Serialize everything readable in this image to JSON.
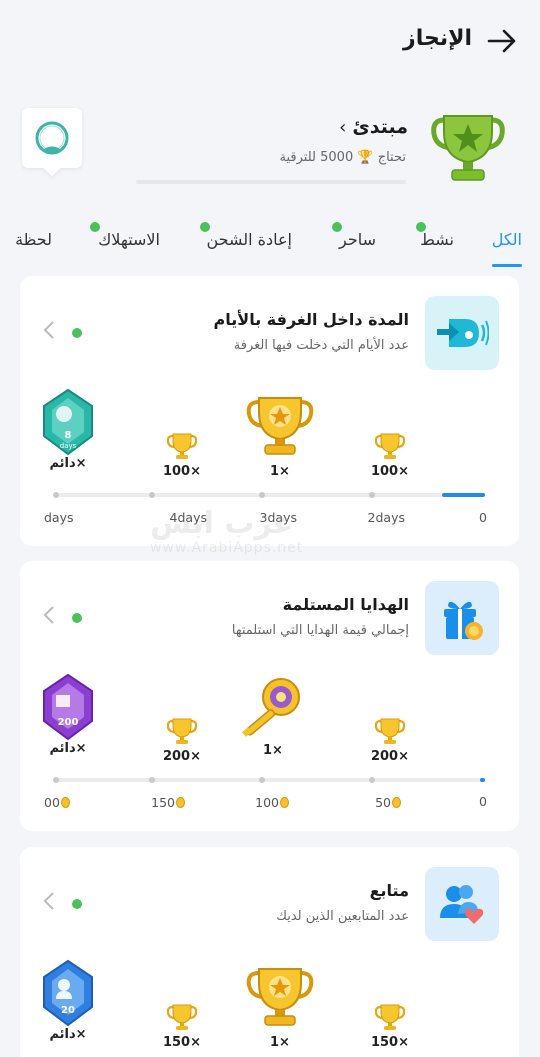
{
  "header": {
    "title": "الإنجاز",
    "back_icon": "arrow-right-icon"
  },
  "rank": {
    "name": "مبتدئ",
    "need_prefix": "تحتاج",
    "need_amount": "5000",
    "need_suffix": "للترقية",
    "progress": 0.0,
    "trophy_color": "#7cbf2a"
  },
  "tabs": [
    {
      "label": "الكل",
      "active": true,
      "dot": false
    },
    {
      "label": "نشط",
      "active": false,
      "dot": true
    },
    {
      "label": "ساحر",
      "active": false,
      "dot": true
    },
    {
      "label": "إعادة الشحن",
      "active": false,
      "dot": true
    },
    {
      "label": "الاستهلاك",
      "active": false,
      "dot": true
    },
    {
      "label": "لحظة",
      "active": false,
      "dot": false
    }
  ],
  "cards": [
    {
      "title": "المدة داخل الغرفة بالأيام",
      "subtitle": "عدد الأيام التي دخلت فيها الغرفة",
      "icon": "room-enter-icon",
      "icon_bg": "#dff3fb",
      "rewards": [
        "100×",
        "1×",
        "100×",
        "دائم×"
      ],
      "badge_text": "8",
      "badge_sub": "days",
      "ticks": [
        "0",
        "2days",
        "3days",
        "4days",
        "days"
      ],
      "progress": 0.1
    },
    {
      "title": "الهدايا المستلمة",
      "subtitle": "إجمالي قيمة الهدايا التي استلمتها",
      "icon": "gift-icon",
      "icon_bg": "#dff0fb",
      "rewards": [
        "200×",
        "1×",
        "200×",
        "دائم×"
      ],
      "badge_text": "200",
      "ticks": [
        "0",
        "50",
        "100",
        "150",
        "00"
      ],
      "progress": 0.01
    },
    {
      "title": "متابع",
      "subtitle": "عدد المتابعين الذين لديك",
      "icon": "followers-icon",
      "icon_bg": "#dff0fb",
      "rewards": [
        "150×",
        "1×",
        "150×",
        "دائم×"
      ],
      "badge_text": "20"
    }
  ],
  "watermark": {
    "text": "عرب ابس",
    "url": "www.ArabiApps.net"
  }
}
